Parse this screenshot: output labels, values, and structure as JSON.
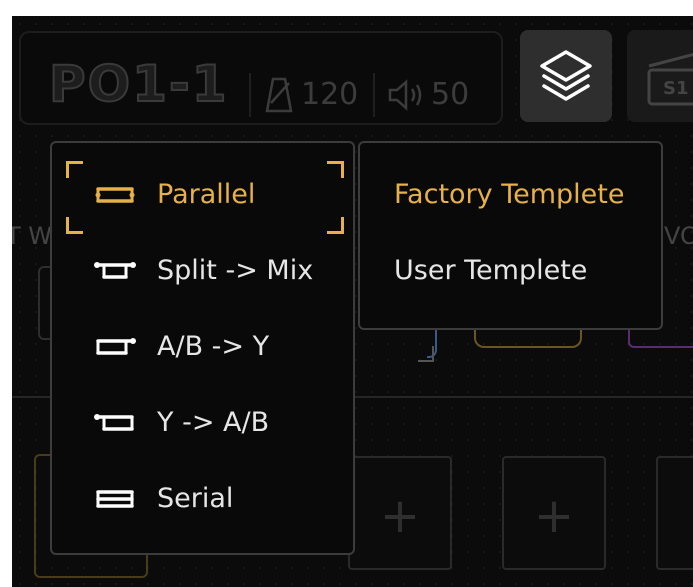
{
  "header": {
    "preset_name": "PO1-1",
    "tempo": "120",
    "volume": "50",
    "slot_label": "S1"
  },
  "background": {
    "partial_left_text": "T W",
    "partial_right_text": "VO"
  },
  "routing_menu": {
    "items": [
      {
        "label": "Parallel",
        "icon": "parallel-icon",
        "active": true
      },
      {
        "label": "Split -> Mix",
        "icon": "split-mix-icon",
        "active": false
      },
      {
        "label": "A/B -> Y",
        "icon": "ab-y-icon",
        "active": false
      },
      {
        "label": "Y -> A/B",
        "icon": "y-ab-icon",
        "active": false
      },
      {
        "label": "Serial",
        "icon": "serial-icon",
        "active": false
      }
    ]
  },
  "template_menu": {
    "items": [
      {
        "label": "Factory Templete",
        "active": true
      },
      {
        "label": "User Templete",
        "active": false
      }
    ]
  },
  "add_slots": [
    "+",
    "+"
  ],
  "colors": {
    "accent": "#e6b04a",
    "menu_border": "#3c3c3c",
    "text": "#e6e6e6",
    "background": "#0b0b0b"
  }
}
